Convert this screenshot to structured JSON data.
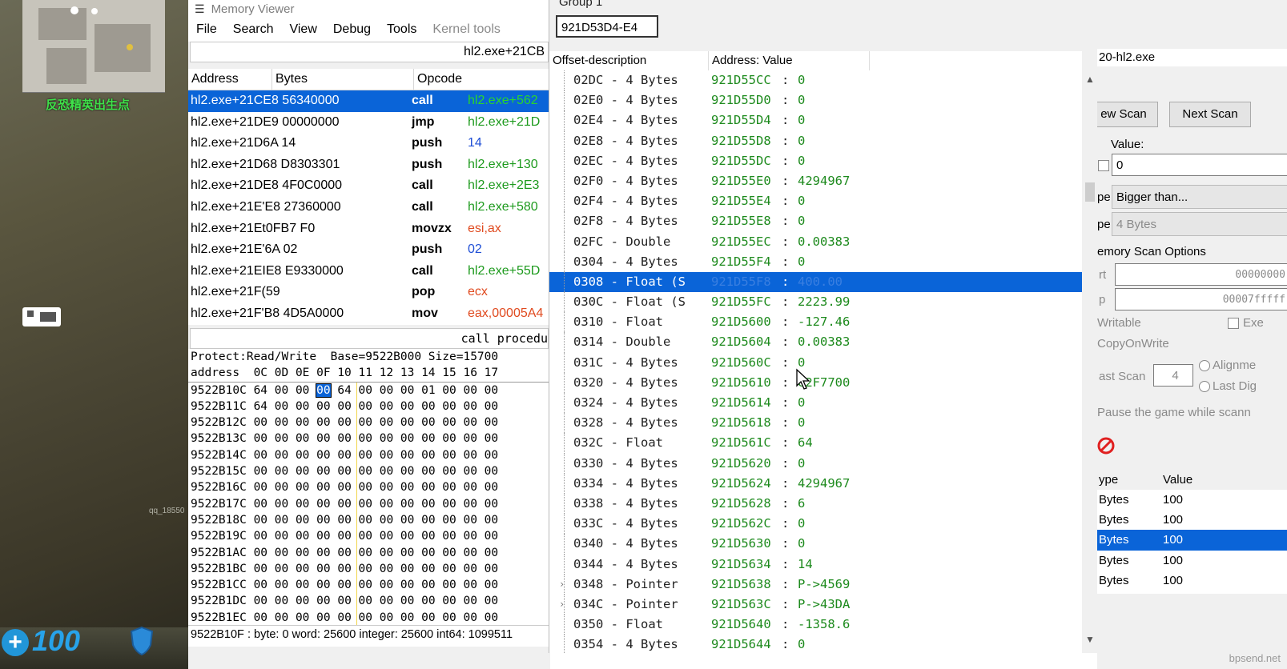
{
  "game": {
    "spawn_text": "反恐精英出生点",
    "qq_text": "qq_18550",
    "health": "100"
  },
  "memory_viewer": {
    "title": "Memory Viewer",
    "menu": [
      "File",
      "Search",
      "View",
      "Debug",
      "Tools",
      "Kernel tools"
    ],
    "address_bar": "hl2.exe+21CB",
    "columns": [
      "Address",
      "Bytes",
      "Opcode"
    ],
    "disasm": [
      {
        "addr": "hl2.exe+21CE8 56340000",
        "op": "call",
        "arg": "hl2.exe+562",
        "color": "#2bd62b"
      },
      {
        "addr": "hl2.exe+21DE9 00000000",
        "op": "jmp",
        "arg": "hl2.exe+21D",
        "color": "#1d9a1d"
      },
      {
        "addr": "hl2.exe+21D6A 14",
        "op": "push",
        "arg": "14",
        "color": "#1f4fd6"
      },
      {
        "addr": "hl2.exe+21D68 D8303301",
        "op": "push",
        "arg": "hl2.exe+130",
        "color": "#1d9a1d"
      },
      {
        "addr": "hl2.exe+21DE8 4F0C0000",
        "op": "call",
        "arg": "hl2.exe+2E3",
        "color": "#1d9a1d"
      },
      {
        "addr": "hl2.exe+21E'E8 27360000",
        "op": "call",
        "arg": "hl2.exe+580",
        "color": "#1d9a1d"
      },
      {
        "addr": "hl2.exe+21Et0FB7 F0",
        "op": "movzx",
        "arg": "esi,ax",
        "color": "#e04a1f"
      },
      {
        "addr": "hl2.exe+21E'6A 02",
        "op": "push",
        "arg": "02",
        "color": "#1f4fd6"
      },
      {
        "addr": "hl2.exe+21EIE8 E9330000",
        "op": "call",
        "arg": "hl2.exe+55D",
        "color": "#1d9a1d"
      },
      {
        "addr": "hl2.exe+21F(59",
        "op": "pop",
        "arg": "ecx",
        "color": "#e04a1f"
      },
      {
        "addr": "hl2.exe+21F'B8 4D5A0000",
        "op": "mov",
        "arg": "eax,00005A4",
        "color": "#e04a1f"
      }
    ],
    "disasm_status": "call procedu",
    "hex_header1": "Protect:Read/Write  Base=9522B000 Size=15700",
    "hex_header2": "address  0C 0D 0E 0F 10 11 12 13 14 15 16 17",
    "hex_rows": [
      {
        "a": "9522B10C",
        "pre": " 64 00 00 ",
        "sel": "00",
        "post": " 64 00 00 00 01 00 00 00"
      },
      {
        "a": "9522B11C",
        "pre": " 64 00 00 ",
        "sel": "",
        "post": "00 00 00 00 00 00 00 00 00"
      },
      {
        "a": "9522B12C",
        "pre": " 00 00 00 ",
        "sel": "",
        "post": "00 00 00 00 00 00 00 00 00"
      },
      {
        "a": "9522B13C",
        "pre": " 00 00 00 ",
        "sel": "",
        "post": "00 00 00 00 00 00 00 00 00"
      },
      {
        "a": "9522B14C",
        "pre": " 00 00 00 ",
        "sel": "",
        "post": "00 00 00 00 00 00 00 00 00"
      },
      {
        "a": "9522B15C",
        "pre": " 00 00 00 ",
        "sel": "",
        "post": "00 00 00 00 00 00 00 00 00"
      },
      {
        "a": "9522B16C",
        "pre": " 00 00 00 ",
        "sel": "",
        "post": "00 00 00 00 00 00 00 00 00"
      },
      {
        "a": "9522B17C",
        "pre": " 00 00 00 ",
        "sel": "",
        "post": "00 00 00 00 00 00 00 00 00"
      },
      {
        "a": "9522B18C",
        "pre": " 00 00 00 ",
        "sel": "",
        "post": "00 00 00 00 00 00 00 00 00"
      },
      {
        "a": "9522B19C",
        "pre": " 00 00 00 ",
        "sel": "",
        "post": "00 00 00 00 00 00 00 00 00"
      },
      {
        "a": "9522B1AC",
        "pre": " 00 00 00 ",
        "sel": "",
        "post": "00 00 00 00 00 00 00 00 00"
      },
      {
        "a": "9522B1BC",
        "pre": " 00 00 00 ",
        "sel": "",
        "post": "00 00 00 00 00 00 00 00 00"
      },
      {
        "a": "9522B1CC",
        "pre": " 00 00 00 ",
        "sel": "",
        "post": "00 00 00 00 00 00 00 00 00"
      },
      {
        "a": "9522B1DC",
        "pre": " 00 00 00 ",
        "sel": "",
        "post": "00 00 00 00 00 00 00 00 00"
      },
      {
        "a": "9522B1EC",
        "pre": " 00 00 00 ",
        "sel": "",
        "post": "00 00 00 00 00 00 00 00 00"
      }
    ],
    "hex_status": "9522B10F : byte: 0 word: 25600 integer: 25600 int64: 1099511"
  },
  "structure": {
    "group_label": "Group 1",
    "group_address": "921D53D4-E4",
    "columns": [
      "Offset-description",
      "Address: Value"
    ],
    "rows": [
      {
        "off": "02DC",
        "type": "4 Bytes",
        "addr": "921D55CC",
        "val": "0"
      },
      {
        "off": "02E0",
        "type": "4 Bytes",
        "addr": "921D55D0",
        "val": "0"
      },
      {
        "off": "02E4",
        "type": "4 Bytes",
        "addr": "921D55D4",
        "val": "0"
      },
      {
        "off": "02E8",
        "type": "4 Bytes",
        "addr": "921D55D8",
        "val": "0"
      },
      {
        "off": "02EC",
        "type": "4 Bytes",
        "addr": "921D55DC",
        "val": "0"
      },
      {
        "off": "02F0",
        "type": "4 Bytes",
        "addr": "921D55E0",
        "val": "4294967"
      },
      {
        "off": "02F4",
        "type": "4 Bytes",
        "addr": "921D55E4",
        "val": "0"
      },
      {
        "off": "02F8",
        "type": "4 Bytes",
        "addr": "921D55E8",
        "val": "0"
      },
      {
        "off": "02FC",
        "type": "Double",
        "addr": "921D55EC",
        "val": "0.00383"
      },
      {
        "off": "0304",
        "type": "4 Bytes",
        "addr": "921D55F4",
        "val": "0"
      },
      {
        "off": "0308",
        "type": "Float (S",
        "addr": "921D55F8",
        "val": "400.00",
        "sel": true
      },
      {
        "off": "030C",
        "type": "Float (S",
        "addr": "921D55FC",
        "val": "2223.99"
      },
      {
        "off": "0310",
        "type": "Float",
        "addr": "921D5600",
        "val": "-127.46"
      },
      {
        "off": "0314",
        "type": "Double",
        "addr": "921D5604",
        "val": "0.00383"
      },
      {
        "off": "031C",
        "type": "4 Bytes",
        "addr": "921D560C",
        "val": "0"
      },
      {
        "off": "0320",
        "type": "4 Bytes",
        "addr": "921D5610",
        "val": "02F7700"
      },
      {
        "off": "0324",
        "type": "4 Bytes",
        "addr": "921D5614",
        "val": "0"
      },
      {
        "off": "0328",
        "type": "4 Bytes",
        "addr": "921D5618",
        "val": "0"
      },
      {
        "off": "032C",
        "type": "Float",
        "addr": "921D561C",
        "val": "64"
      },
      {
        "off": "0330",
        "type": "4 Bytes",
        "addr": "921D5620",
        "val": "0"
      },
      {
        "off": "0334",
        "type": "4 Bytes",
        "addr": "921D5624",
        "val": "4294967"
      },
      {
        "off": "0338",
        "type": "4 Bytes",
        "addr": "921D5628",
        "val": "6"
      },
      {
        "off": "033C",
        "type": "4 Bytes",
        "addr": "921D562C",
        "val": "0"
      },
      {
        "off": "0340",
        "type": "4 Bytes",
        "addr": "921D5630",
        "val": "0"
      },
      {
        "off": "0344",
        "type": "4 Bytes",
        "addr": "921D5634",
        "val": "14"
      },
      {
        "off": "0348",
        "type": "Pointer",
        "addr": "921D5638",
        "val": "P->4569",
        "exp": true
      },
      {
        "off": "034C",
        "type": "Pointer",
        "addr": "921D563C",
        "val": "P->43DA",
        "exp": true
      },
      {
        "off": "0350",
        "type": "Float",
        "addr": "921D5640",
        "val": "-1358.6"
      },
      {
        "off": "0354",
        "type": "4 Bytes",
        "addr": "921D5644",
        "val": "0"
      }
    ]
  },
  "cheat_engine": {
    "title": "20-hl2.exe",
    "new_scan": "ew Scan",
    "next_scan": "Next Scan",
    "value_label": "Value:",
    "value_input": "0",
    "scan_type_label": "pe",
    "scan_type": "Bigger than...",
    "value_type_label": "pe",
    "value_type": "4 Bytes",
    "scan_options": "emory Scan Options",
    "start_label": "rt",
    "start_value": "00000000",
    "stop_label": "p",
    "stop_value": "00007fffff",
    "writable": "Writable",
    "executable": "Exe",
    "copy_on_write": "CopyOnWrite",
    "fast_scan": "ast Scan",
    "fast_scan_value": "4",
    "alignment": "Alignme",
    "last_digits": "Last Dig",
    "pause": "Pause the game while scann",
    "list_columns": [
      "ype",
      "Value"
    ],
    "list_rows": [
      {
        "type": "Bytes",
        "value": "100"
      },
      {
        "type": "Bytes",
        "value": "100"
      },
      {
        "type": "Bytes",
        "value": "100",
        "sel": true
      },
      {
        "type": "Bytes",
        "value": "100"
      },
      {
        "type": "Bytes",
        "value": "100"
      }
    ],
    "watermark": "bpsend.net"
  }
}
